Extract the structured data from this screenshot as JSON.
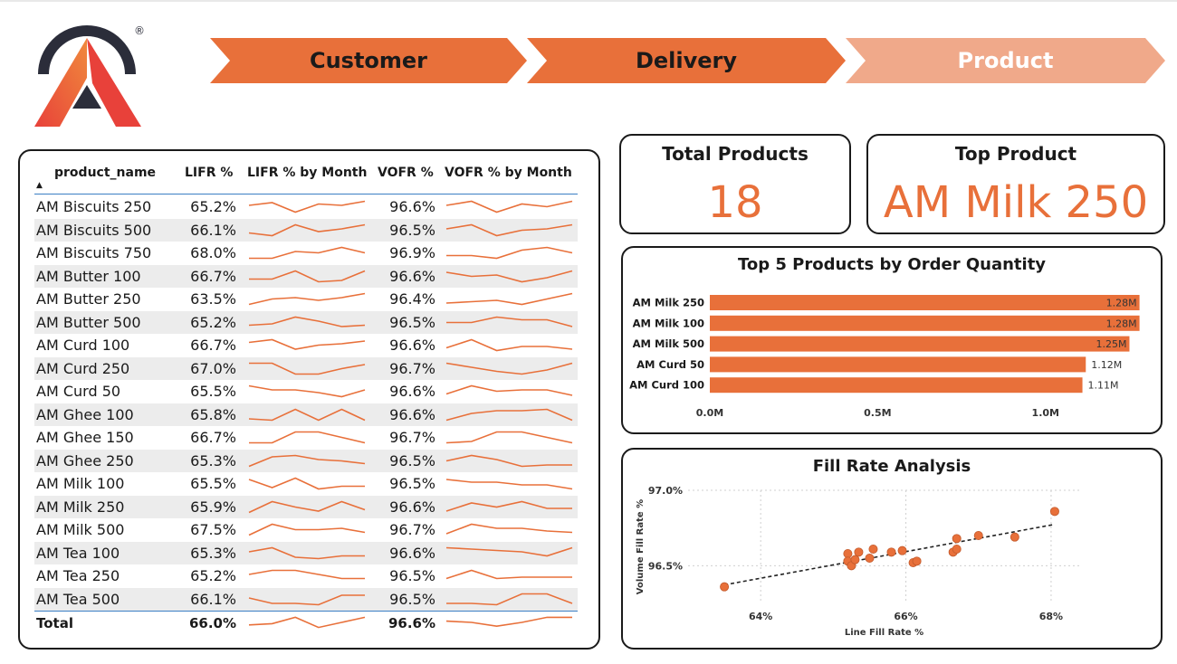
{
  "colors": {
    "accent": "#e8703a",
    "nav_active": "#e8703a",
    "nav_inactive": "#f0a98a",
    "nav_active_text": "#1a1a1a",
    "nav_inactive_text": "#ffffff",
    "logo_red": "#e8413a",
    "logo_dark": "#2b2d3a"
  },
  "logo": {
    "registered_mark": "®"
  },
  "nav": {
    "items": [
      {
        "label": "Customer"
      },
      {
        "label": "Delivery"
      },
      {
        "label": "Product"
      }
    ]
  },
  "table": {
    "headers": {
      "product_name": "product_name",
      "lifr": "LIFR %",
      "lifr_month": "LIFR % by Month",
      "vofr": "VOFR %",
      "vofr_month": "VOFR % by Month"
    },
    "sort_indicator": "▲",
    "rows": [
      {
        "name": "AM Biscuits 250",
        "lifr": "65.2%",
        "vofr": "96.6%",
        "lifr_trend": [
          0.6,
          0.8,
          0.1,
          0.7,
          0.6,
          0.9
        ],
        "vofr_trend": [
          0.6,
          0.9,
          0.1,
          0.7,
          0.5,
          0.9
        ]
      },
      {
        "name": "AM Biscuits 500",
        "lifr": "66.1%",
        "vofr": "96.5%",
        "lifr_trend": [
          0.3,
          0.1,
          0.9,
          0.4,
          0.6,
          0.9
        ],
        "vofr_trend": [
          0.6,
          0.9,
          0.1,
          0.5,
          0.6,
          0.9
        ]
      },
      {
        "name": "AM Biscuits 750",
        "lifr": "68.0%",
        "vofr": "96.9%",
        "lifr_trend": [
          0.1,
          0.1,
          0.6,
          0.5,
          0.9,
          0.5
        ],
        "vofr_trend": [
          0.3,
          0.3,
          0.1,
          0.7,
          0.9,
          0.5
        ]
      },
      {
        "name": "AM Butter 100",
        "lifr": "66.7%",
        "vofr": "96.6%",
        "lifr_trend": [
          0.3,
          0.3,
          0.9,
          0.1,
          0.2,
          0.9
        ],
        "vofr_trend": [
          0.8,
          0.5,
          0.6,
          0.1,
          0.4,
          0.9
        ]
      },
      {
        "name": "AM Butter 250",
        "lifr": "63.5%",
        "vofr": "96.4%",
        "lifr_trend": [
          0.1,
          0.5,
          0.6,
          0.4,
          0.6,
          0.9
        ],
        "vofr_trend": [
          0.2,
          0.3,
          0.4,
          0.1,
          0.5,
          0.9
        ]
      },
      {
        "name": "AM Butter 500",
        "lifr": "65.2%",
        "vofr": "96.5%",
        "lifr_trend": [
          0.3,
          0.4,
          0.9,
          0.6,
          0.2,
          0.3
        ],
        "vofr_trend": [
          0.5,
          0.5,
          0.9,
          0.7,
          0.7,
          0.2
        ]
      },
      {
        "name": "AM Curd 100",
        "lifr": "66.7%",
        "vofr": "96.6%",
        "lifr_trend": [
          0.7,
          0.9,
          0.2,
          0.5,
          0.6,
          0.8
        ],
        "vofr_trend": [
          0.3,
          0.9,
          0.1,
          0.4,
          0.4,
          0.2
        ]
      },
      {
        "name": "AM Curd 250",
        "lifr": "67.0%",
        "vofr": "96.7%",
        "lifr_trend": [
          0.9,
          0.9,
          0.1,
          0.1,
          0.5,
          0.8
        ],
        "vofr_trend": [
          0.9,
          0.6,
          0.3,
          0.1,
          0.4,
          0.9
        ]
      },
      {
        "name": "AM Curd 50",
        "lifr": "65.5%",
        "vofr": "96.6%",
        "lifr_trend": [
          0.9,
          0.6,
          0.6,
          0.4,
          0.1,
          0.6
        ],
        "vofr_trend": [
          0.3,
          0.9,
          0.5,
          0.6,
          0.6,
          0.2
        ]
      },
      {
        "name": "AM Ghee 100",
        "lifr": "65.8%",
        "vofr": "96.6%",
        "lifr_trend": [
          0.2,
          0.1,
          0.9,
          0.1,
          0.9,
          0.1
        ],
        "vofr_trend": [
          0.1,
          0.6,
          0.8,
          0.8,
          0.9,
          0.1
        ]
      },
      {
        "name": "AM Ghee 150",
        "lifr": "66.7%",
        "vofr": "96.7%",
        "lifr_trend": [
          0.1,
          0.1,
          0.9,
          0.9,
          0.5,
          0.1
        ],
        "vofr_trend": [
          0.1,
          0.2,
          0.9,
          0.9,
          0.5,
          0.1
        ]
      },
      {
        "name": "AM Ghee 250",
        "lifr": "65.3%",
        "vofr": "96.5%",
        "lifr_trend": [
          0.1,
          0.8,
          0.9,
          0.6,
          0.5,
          0.3
        ],
        "vofr_trend": [
          0.5,
          0.9,
          0.6,
          0.1,
          0.2,
          0.2
        ]
      },
      {
        "name": "AM Milk 100",
        "lifr": "65.5%",
        "vofr": "96.5%",
        "lifr_trend": [
          0.8,
          0.2,
          0.9,
          0.1,
          0.3,
          0.3
        ],
        "vofr_trend": [
          0.8,
          0.6,
          0.6,
          0.4,
          0.4,
          0.1
        ]
      },
      {
        "name": "AM Milk 250",
        "lifr": "65.9%",
        "vofr": "96.6%",
        "lifr_trend": [
          0.1,
          0.9,
          0.5,
          0.2,
          0.9,
          0.3
        ],
        "vofr_trend": [
          0.2,
          0.8,
          0.5,
          0.9,
          0.4,
          0.4
        ]
      },
      {
        "name": "AM Milk 500",
        "lifr": "67.5%",
        "vofr": "96.7%",
        "lifr_trend": [
          0.1,
          0.9,
          0.5,
          0.5,
          0.6,
          0.3
        ],
        "vofr_trend": [
          0.2,
          0.9,
          0.6,
          0.6,
          0.4,
          0.3
        ]
      },
      {
        "name": "AM Tea 100",
        "lifr": "65.3%",
        "vofr": "96.6%",
        "lifr_trend": [
          0.6,
          0.9,
          0.2,
          0.1,
          0.3,
          0.3
        ],
        "vofr_trend": [
          0.9,
          0.8,
          0.7,
          0.6,
          0.3,
          0.9
        ]
      },
      {
        "name": "AM Tea 250",
        "lifr": "65.2%",
        "vofr": "96.5%",
        "lifr_trend": [
          0.6,
          0.9,
          0.9,
          0.6,
          0.3,
          0.3
        ],
        "vofr_trend": [
          0.3,
          0.9,
          0.3,
          0.4,
          0.4,
          0.4
        ]
      },
      {
        "name": "AM Tea 500",
        "lifr": "66.1%",
        "vofr": "96.5%",
        "lifr_trend": [
          0.6,
          0.2,
          0.2,
          0.1,
          0.8,
          0.8
        ],
        "vofr_trend": [
          0.2,
          0.2,
          0.1,
          0.9,
          0.9,
          0.2
        ]
      }
    ],
    "total": {
      "name": "Total",
      "lifr": "66.0%",
      "vofr": "96.6%",
      "lifr_trend": [
        0.3,
        0.4,
        0.9,
        0.1,
        0.5,
        0.9
      ],
      "vofr_trend": [
        0.6,
        0.5,
        0.2,
        0.5,
        0.9,
        0.9
      ]
    }
  },
  "kpis": {
    "total_products": {
      "label": "Total Products",
      "value": "18"
    },
    "top_product": {
      "label": "Top Product",
      "value": "AM Milk 250"
    }
  },
  "chart_data": [
    {
      "type": "bar",
      "orientation": "horizontal",
      "title": "Top 5 Products by Order Quantity",
      "categories": [
        "AM Milk 250",
        "AM Milk 100",
        "AM Milk 500",
        "AM Curd 50",
        "AM Curd 100"
      ],
      "values": [
        1280000,
        1280000,
        1250000,
        1120000,
        1110000
      ],
      "data_labels": [
        "1.28M",
        "1.28M",
        "1.25M",
        "1.12M",
        "1.11M"
      ],
      "xticks": [
        "0.0M",
        "0.5M",
        "1.0M"
      ],
      "xtick_values": [
        0,
        500000,
        1000000
      ],
      "xlim": [
        0,
        1300000
      ],
      "color": "#e8703a",
      "grid": false
    },
    {
      "type": "scatter",
      "title": "Fill Rate Analysis",
      "xlabel": "Line Fill Rate %",
      "ylabel": "Volume Fill Rate %",
      "xticks": [
        "64%",
        "66%",
        "68%"
      ],
      "xtick_values": [
        64,
        66,
        68
      ],
      "yticks": [
        "97.0%",
        "96.5%"
      ],
      "ytick_values": [
        97.0,
        96.5
      ],
      "xlim": [
        63.0,
        68.4
      ],
      "ylim": [
        96.37,
        97.0
      ],
      "grid": true,
      "trendline": true,
      "color": "#e8703a",
      "points": [
        {
          "x": 63.5,
          "y": 96.36
        },
        {
          "x": 65.2,
          "y": 96.58
        },
        {
          "x": 65.2,
          "y": 96.53
        },
        {
          "x": 65.25,
          "y": 96.5
        },
        {
          "x": 65.3,
          "y": 96.54
        },
        {
          "x": 65.35,
          "y": 96.59
        },
        {
          "x": 65.5,
          "y": 96.55
        },
        {
          "x": 65.55,
          "y": 96.61
        },
        {
          "x": 65.8,
          "y": 96.59
        },
        {
          "x": 65.95,
          "y": 96.6
        },
        {
          "x": 66.1,
          "y": 96.52
        },
        {
          "x": 66.15,
          "y": 96.53
        },
        {
          "x": 66.65,
          "y": 96.59
        },
        {
          "x": 66.7,
          "y": 96.61
        },
        {
          "x": 66.7,
          "y": 96.68
        },
        {
          "x": 67.0,
          "y": 96.7
        },
        {
          "x": 67.5,
          "y": 96.69
        },
        {
          "x": 68.05,
          "y": 96.86
        }
      ]
    }
  ]
}
